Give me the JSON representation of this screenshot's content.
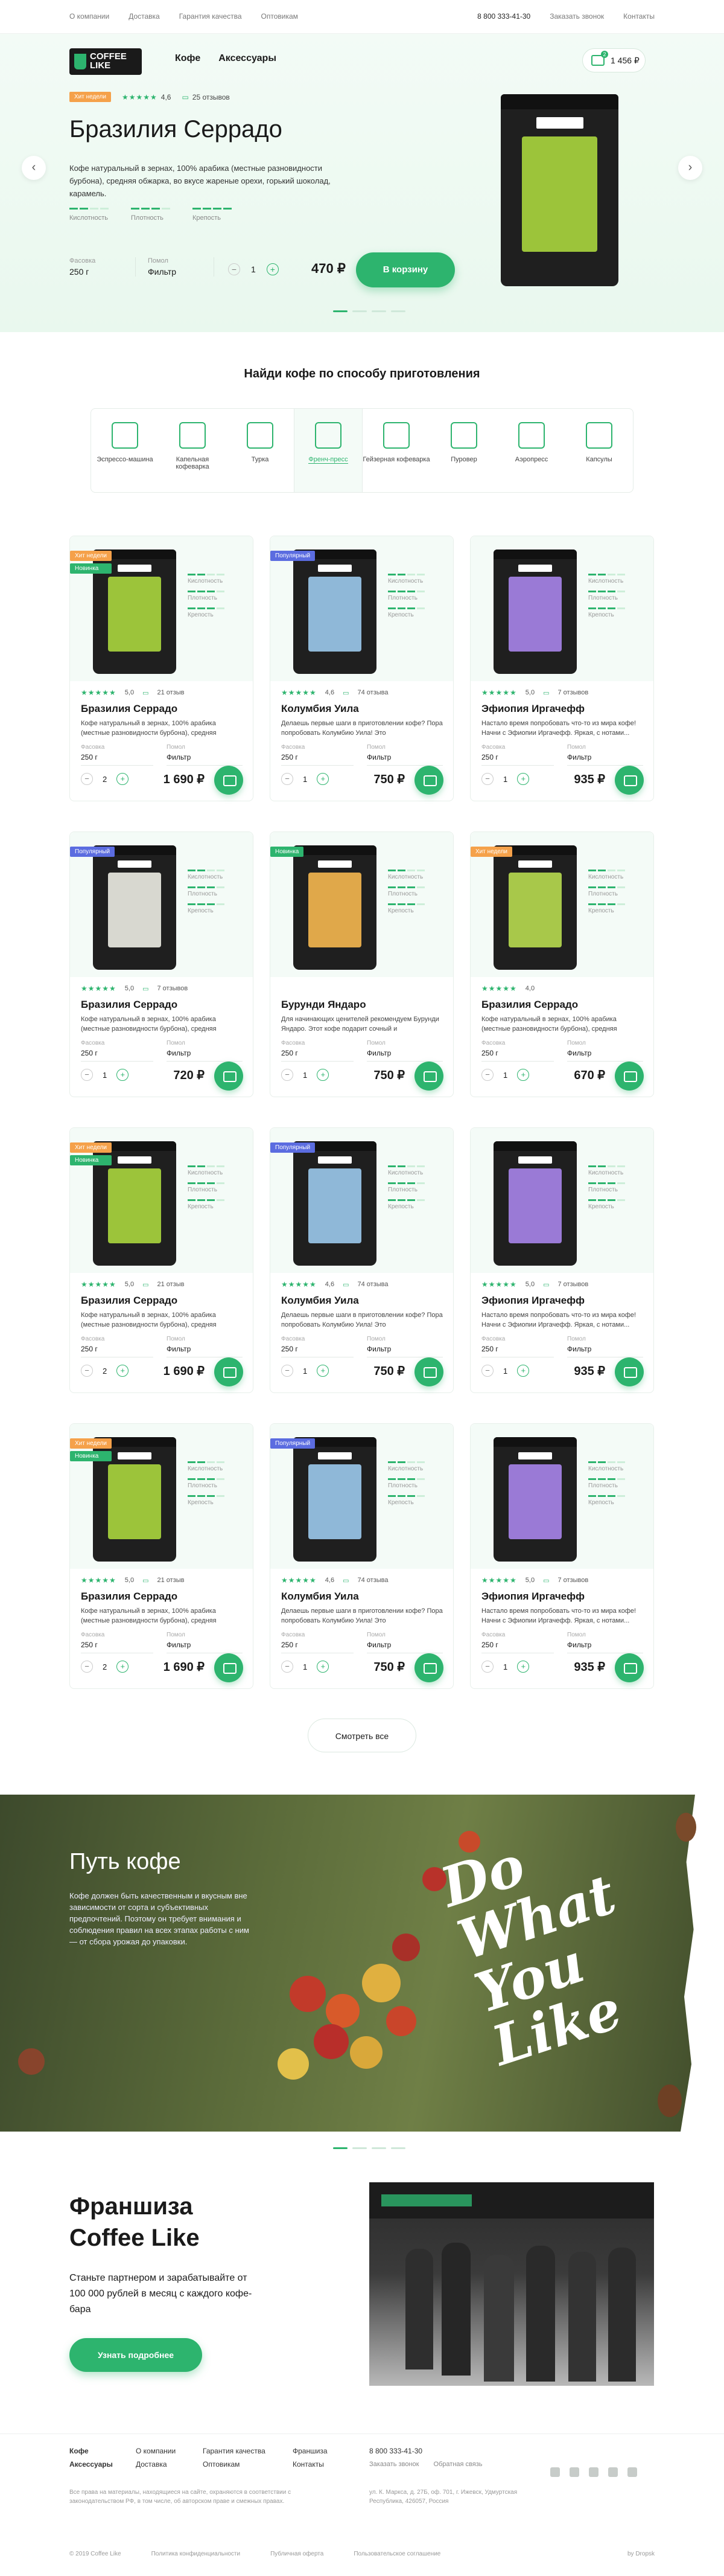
{
  "topnav": {
    "left": [
      "О компании",
      "Доставка",
      "Гарантия качества",
      "Оптовикам"
    ],
    "phone": "8 800 333-41-30",
    "callback": "Заказать звонок",
    "contacts": "Контакты"
  },
  "logo": {
    "line1": "COFFEE",
    "line2": "LIKE"
  },
  "mainnav": [
    "Кофе",
    "Аксессуары"
  ],
  "cart": {
    "amount": "1 456 ₽",
    "count": "2"
  },
  "hero": {
    "badge": "Хит недели",
    "rating": "4,6",
    "reviews": "25 отзывов",
    "title": "Бразилия Серрадо",
    "desc": "Кофе натуральный в зернах, 100% арабика (местные разновидности бурбона), средняя обжарка, во вкусе жареные орехи, горький шоколад, карамель.",
    "bars": [
      {
        "label": "Кислотность",
        "level": 0.4
      },
      {
        "label": "Плотность",
        "level": 0.6
      },
      {
        "label": "Крепость",
        "level": 0.8
      }
    ],
    "pack_label": "Фасовка",
    "pack_value": "250 г",
    "grind_label": "Помол",
    "grind_value": "Фильтр",
    "qty": "1",
    "price": "470 ₽",
    "button": "В корзину"
  },
  "methods_title": "Найди кофе по способу приготовления",
  "methods": [
    {
      "label": "Эспрессо-машина",
      "icon": "espresso-machine-icon"
    },
    {
      "label": "Капельная кофеварка",
      "icon": "drip-coffee-maker-icon"
    },
    {
      "label": "Турка",
      "icon": "turka-icon"
    },
    {
      "label": "Френч-пресс",
      "icon": "french-press-icon",
      "active": true
    },
    {
      "label": "Гейзерная кофеварка",
      "icon": "geyser-icon"
    },
    {
      "label": "Пуровер",
      "icon": "pourover-icon"
    },
    {
      "label": "Аэропресс",
      "icon": "aeropress-icon"
    },
    {
      "label": "Капсулы",
      "icon": "capsules-icon"
    }
  ],
  "card_labels": {
    "acid": "Кислотность",
    "dens": "Плотность",
    "str": "Крепость",
    "pack": "Фасовка",
    "grind": "Помол"
  },
  "products": [
    {
      "name": "Бразилия Серрадо",
      "badges": [
        [
          "Хит недели",
          "orange"
        ],
        [
          "Новинка",
          "green"
        ]
      ],
      "rating": "5,0",
      "reviews": "21 отзыв",
      "desc": "Кофе натуральный в зернах, 100% арабика (местные разновидности бурбона), средняя обжарка, во вкусе...",
      "pack": "250 г",
      "grind": "Фильтр",
      "qty": "2",
      "price": "1 690 ₽",
      "color": "#9cc43a"
    },
    {
      "name": "Колумбия Уила",
      "badges": [
        [
          "Популярный",
          "blue"
        ]
      ],
      "rating": "4,6",
      "reviews": "74 отзыва",
      "desc": "Делаешь первые шаги в приготовлении кофе? Пора попробовать Колумбию Уила! Это сбалансированны...",
      "pack": "250 г",
      "grind": "Фильтр",
      "qty": "1",
      "price": "750 ₽",
      "color": "#8fb8d8"
    },
    {
      "name": "Эфиопия Иргачефф",
      "badges": [],
      "rating": "5,0",
      "reviews": "7 отзывов",
      "desc": "Настало время попробовать что-то из мира кофе! Начни с Эфиопии Иргачефф. Яркая, с нотами...",
      "pack": "250 г",
      "grind": "Фильтр",
      "qty": "1",
      "price": "935 ₽",
      "color": "#9a7ad6"
    },
    {
      "name": "Бразилия Серрадо",
      "badges": [
        [
          "Популярный",
          "blue"
        ]
      ],
      "rating": "5,0",
      "reviews": "7 отзывов",
      "desc": "Кофе натуральный в зернах, 100% арабика (местные разновидности бурбона), средняя обжарка, во вкусе...",
      "pack": "250 г",
      "grind": "Фильтр",
      "qty": "1",
      "price": "720 ₽",
      "color": "#d8d8d0"
    },
    {
      "name": "Бурунди Яндаро",
      "badges": [
        [
          "Новинка",
          "green"
        ]
      ],
      "rating": "",
      "reviews": "",
      "desc": "Для начинающих ценителей рекомендуем Бурунди Яндаро. Этот кофе подарит сочный и непривычный...",
      "pack": "250 г",
      "grind": "Фильтр",
      "qty": "1",
      "price": "750 ₽",
      "color": "#e0a84a"
    },
    {
      "name": "Бразилия Серрадо",
      "badges": [
        [
          "Хит недели",
          "orange"
        ]
      ],
      "rating": "4,0",
      "reviews": "",
      "desc": "Кофе натуральный в зернах, 100% арабика (местные разновидности бурбона), средняя обжарка, во вкусе...",
      "pack": "250 г",
      "grind": "Фильтр",
      "qty": "1",
      "price": "670 ₽",
      "color": "#a8c84a"
    },
    {
      "name": "Бразилия Серрадо",
      "badges": [
        [
          "Хит недели",
          "orange"
        ],
        [
          "Новинка",
          "green"
        ]
      ],
      "rating": "5,0",
      "reviews": "21 отзыв",
      "desc": "Кофе натуральный в зернах, 100% арабика (местные разновидности бурбона), средняя обжарка, во вкусе...",
      "pack": "250 г",
      "grind": "Фильтр",
      "qty": "2",
      "price": "1 690 ₽",
      "color": "#9cc43a"
    },
    {
      "name": "Колумбия Уила",
      "badges": [
        [
          "Популярный",
          "blue"
        ]
      ],
      "rating": "4,6",
      "reviews": "74 отзыва",
      "desc": "Делаешь первые шаги в приготовлении кофе? Пора попробовать Колумбию Уила! Это сбалансированны...",
      "pack": "250 г",
      "grind": "Фильтр",
      "qty": "1",
      "price": "750 ₽",
      "color": "#8fb8d8"
    },
    {
      "name": "Эфиопия Иргачефф",
      "badges": [],
      "rating": "5,0",
      "reviews": "7 отзывов",
      "desc": "Настало время попробовать что-то из мира кофе! Начни с Эфиопии Иргачефф. Яркая, с нотами...",
      "pack": "250 г",
      "grind": "Фильтр",
      "qty": "1",
      "price": "935 ₽",
      "color": "#9a7ad6"
    },
    {
      "name": "Бразилия Серрадо",
      "badges": [
        [
          "Хит недели",
          "orange"
        ],
        [
          "Новинка",
          "green"
        ]
      ],
      "rating": "5,0",
      "reviews": "21 отзыв",
      "desc": "Кофе натуральный в зернах, 100% арабика (местные разновидности бурбона), средняя обжарка, во вкусе...",
      "pack": "250 г",
      "grind": "Фильтр",
      "qty": "2",
      "price": "1 690 ₽",
      "color": "#9cc43a"
    },
    {
      "name": "Колумбия Уила",
      "badges": [
        [
          "Популярный",
          "blue"
        ]
      ],
      "rating": "4,6",
      "reviews": "74 отзыва",
      "desc": "Делаешь первые шаги в приготовлении кофе? Пора попробовать Колумбию Уила! Это сбалансированны...",
      "pack": "250 г",
      "grind": "Фильтр",
      "qty": "1",
      "price": "750 ₽",
      "color": "#8fb8d8"
    },
    {
      "name": "Эфиопия Иргачефф",
      "badges": [],
      "rating": "5,0",
      "reviews": "7 отзывов",
      "desc": "Настало время попробовать что-то из мира кофе! Начни с Эфиопии Иргачефф. Яркая, с нотами...",
      "pack": "250 г",
      "grind": "Фильтр",
      "qty": "1",
      "price": "935 ₽",
      "color": "#9a7ad6"
    }
  ],
  "see_all": "Смотреть все",
  "path": {
    "title": "Путь кофе",
    "text": "Кофе должен быть качественным и вкусным вне зависимости от сорта и субъективных предпочтений. Поэтому он требует внимания и соблюдения правил на всех этапах работы с ним — от сбора урожая до упаковки.",
    "slogan": [
      "Do",
      "What",
      "You",
      "Like"
    ]
  },
  "franchise": {
    "title": "Франшиза Coffee Like",
    "text": "Станьте партнером и зарабатывайте от 100 000 рублей в месяц с каждого кофе-бара",
    "button": "Узнать подробнее"
  },
  "footer": {
    "col1": [
      "Кофе",
      "Аксессуары"
    ],
    "col2": [
      "О компании",
      "Доставка"
    ],
    "col3": [
      "Гарантия качества",
      "Оптовикам"
    ],
    "col4": [
      "Франшиза",
      "Контакты"
    ],
    "phone": "8 800 333-41-30",
    "callback": "Заказать звонок",
    "feedback": "Обратная связь",
    "legal": "Все права на материалы, находящиеся на сайте, охраняются в соответствии с законодательством РФ, в том числе, об авторском праве и смежных правах.",
    "address": "ул. К. Маркса, д. 27Б, оф. 701, г. Ижевск, Удмуртская Республика, 426057, Россия",
    "copyright": "© 2019 Coffee Like",
    "policy": "Политика конфиденциальности",
    "offer": "Публичная оферта",
    "agreement": "Пользовательское соглашение",
    "dev": "by Dropsk",
    "accent": "#2db46e"
  }
}
